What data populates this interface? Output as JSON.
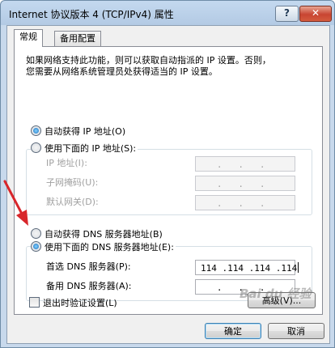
{
  "window": {
    "title": "Internet 协议版本 4 (TCP/IPv4) 属性",
    "help_label": "?",
    "close_label": "✕"
  },
  "tabs": [
    {
      "label": "常规",
      "active": true
    },
    {
      "label": "备用配置",
      "active": false
    }
  ],
  "description": {
    "line1": "如果网络支持此功能，则可以获取自动指派的 IP 设置。否则，",
    "line2": "您需要从网络系统管理员处获得适当的 IP 设置。"
  },
  "ip": {
    "auto_label": "自动获得 IP 地址(O)",
    "manual_label": "使用下面的 IP 地址(S):",
    "auto_checked": true,
    "fields": [
      {
        "label": "IP 地址(I):",
        "value": "   .   .   .   "
      },
      {
        "label": "子网掩码(U):",
        "value": "   .   .   .   "
      },
      {
        "label": "默认网关(D):",
        "value": "   .   .   .   "
      }
    ]
  },
  "dns": {
    "auto_label": "自动获得 DNS 服务器地址(B)",
    "manual_label": "使用下面的 DNS 服务器地址(E):",
    "manual_checked": true,
    "preferred_label": "首选 DNS 服务器(P):",
    "preferred_value": "114 .114 .114 .114",
    "alternate_label": "备用 DNS 服务器(A):",
    "alternate_value": "   .   .   .   "
  },
  "validate_label": "退出时验证设置(L)",
  "advanced_label": "高级(V)...",
  "ok_label": "确定",
  "cancel_label": "取消",
  "watermark": "Bai du 经验",
  "colors": {
    "accent": "#1a6fbf",
    "annotation_arrow": "#d8262b"
  }
}
